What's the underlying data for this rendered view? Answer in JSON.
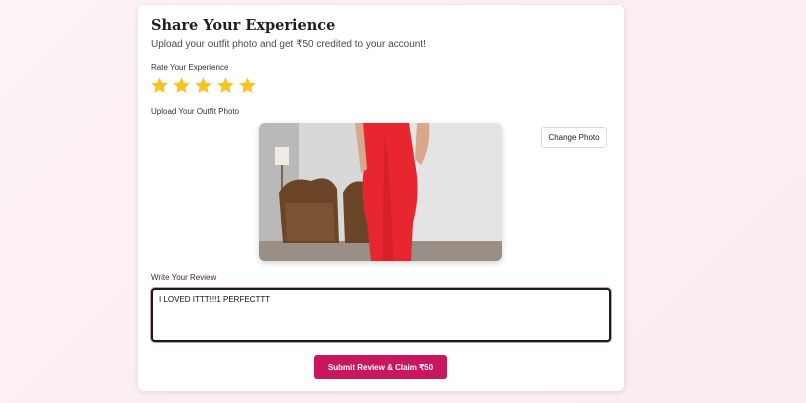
{
  "card": {
    "title": "Share Your Experience",
    "subtitle": "Upload your outfit photo and get ₹50 credited to your account!"
  },
  "rating": {
    "label": "Rate Your Experience",
    "value": 5,
    "max": 5,
    "star_color": "#f7c325"
  },
  "photo_section": {
    "label": "Upload Your Outfit Photo",
    "change_button_label": "Change Photo",
    "image_alt": "Woman in red dress"
  },
  "review": {
    "label": "Write Your Review",
    "value": "I LOVED ITTT!!!1 PERFECTTT"
  },
  "submit": {
    "label": "Submit Review & Claim ₹50",
    "color": "#c8175d"
  }
}
